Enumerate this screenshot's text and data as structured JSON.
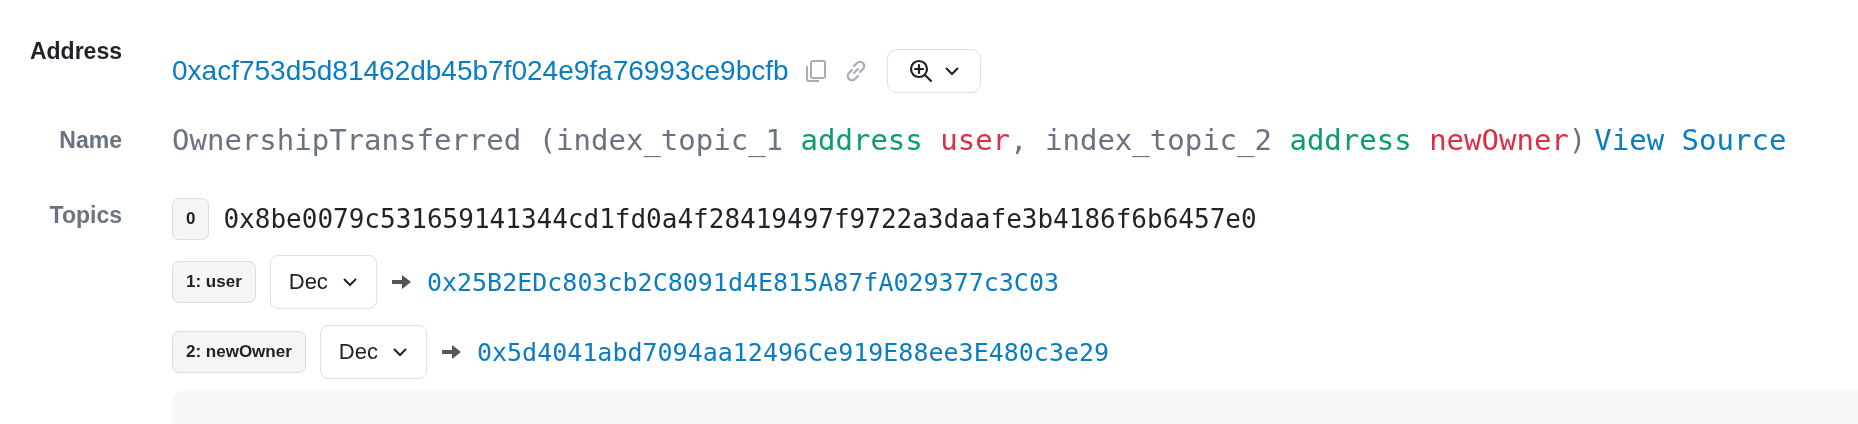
{
  "address": {
    "label": "Address",
    "value": "0xacf753d5d81462db45b7f024e9fa76993ce9bcfb"
  },
  "name": {
    "label": "Name",
    "signature": [
      {
        "kind": "plain",
        "text": "OwnershipTransferred (index_topic_1 "
      },
      {
        "kind": "type",
        "text": "address "
      },
      {
        "kind": "param",
        "text": "user"
      },
      {
        "kind": "plain",
        "text": ", index_topic_2 "
      },
      {
        "kind": "type",
        "text": "address "
      },
      {
        "kind": "param",
        "text": "newOwner"
      },
      {
        "kind": "plain",
        "text": ")"
      }
    ],
    "link": "View Source"
  },
  "topics": {
    "label": "Topics",
    "items": [
      {
        "index": "0",
        "value": "0x8be0079c531659141344cd1fd0a4f28419497f9722a3daafe3b4186f6b6457e0"
      },
      {
        "index": "1: user",
        "format": "Dec",
        "value": "0x25B2EDc803cb2C8091d4E815A87fA029377c3C03"
      },
      {
        "index": "2: newOwner",
        "format": "Dec",
        "value": "0x5d4041abd7094aa12496Ce919E88ee3E480c3e29"
      }
    ]
  }
}
